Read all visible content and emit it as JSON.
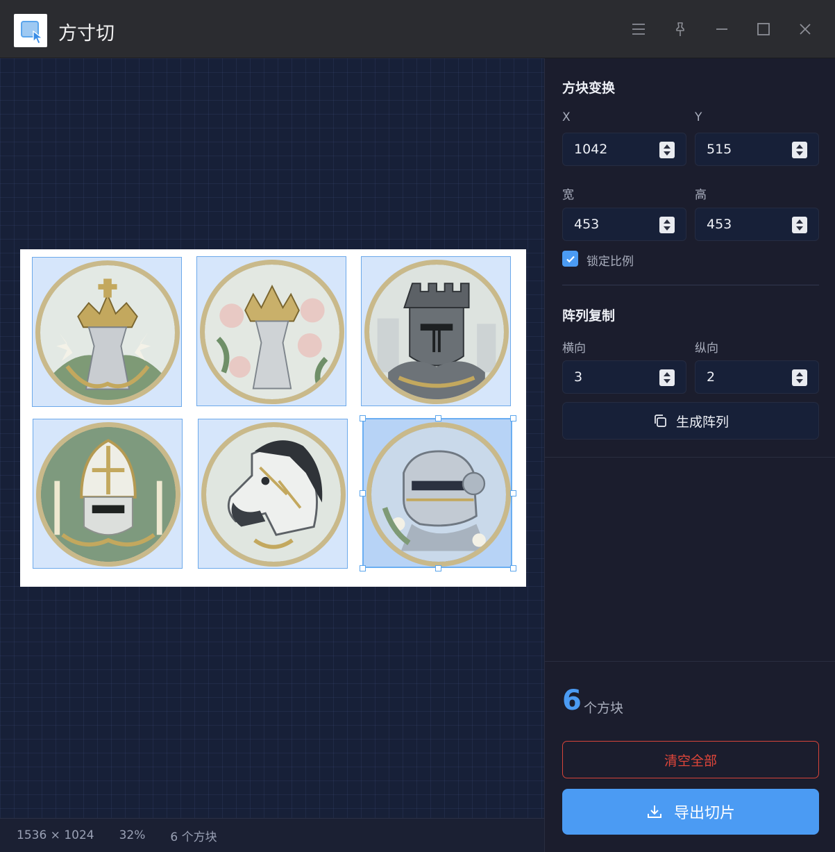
{
  "app": {
    "title": "方寸切"
  },
  "window_controls": [
    "menu-icon",
    "pin-icon",
    "minimize-icon",
    "maximize-icon",
    "close-icon"
  ],
  "status": {
    "dimensions": "1536 × 1024",
    "zoom": "32%",
    "count": "6 个方块"
  },
  "transform": {
    "title": "方块变换",
    "x_label": "X",
    "x_value": "1042",
    "y_label": "Y",
    "y_value": "515",
    "w_label": "宽",
    "w_value": "453",
    "h_label": "高",
    "h_value": "453",
    "lock_label": "锁定比例",
    "lock_checked": true
  },
  "array": {
    "title": "阵列复制",
    "h_label": "横向",
    "h_value": "3",
    "v_label": "纵向",
    "v_value": "2",
    "generate_label": "生成阵列"
  },
  "summary": {
    "count": "6",
    "unit": "个方块"
  },
  "actions": {
    "clear_label": "清空全部",
    "export_label": "导出切片"
  },
  "tiles": [
    {
      "name": "queen-crown-lilies",
      "icon": "chess-queen-icon",
      "selected": false
    },
    {
      "name": "queen-crown-roses",
      "icon": "chess-queen-icon",
      "selected": false
    },
    {
      "name": "rook-knight-helmet",
      "icon": "chess-rook-icon",
      "selected": false
    },
    {
      "name": "bishop-mitre",
      "icon": "chess-bishop-icon",
      "selected": false
    },
    {
      "name": "knight-horse",
      "icon": "chess-knight-icon",
      "selected": false
    },
    {
      "name": "pawn-helmet",
      "icon": "knight-helmet-icon",
      "selected": true
    }
  ],
  "colors": {
    "accent": "#4b9bf3",
    "danger": "#e0463a",
    "panel": "#1b1d2d",
    "canvas": "#172038"
  }
}
